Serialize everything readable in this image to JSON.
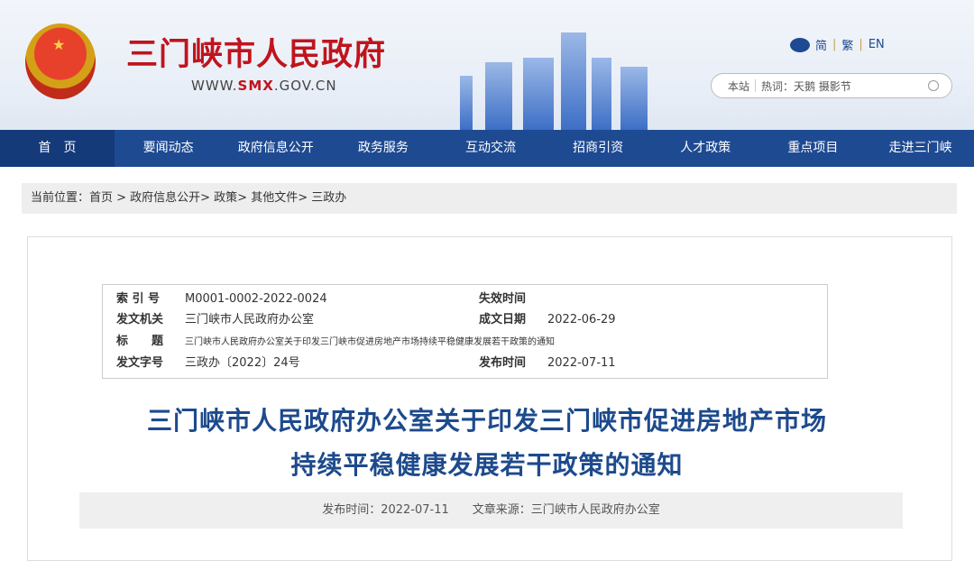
{
  "header": {
    "site_title": "三门峡市人民政府",
    "url_prefix": "WWW.",
    "url_brand": "SMX",
    "url_suffix": ".GOV.CN",
    "emblem_text": "★"
  },
  "lang": {
    "simplified": "简",
    "traditional": "繁",
    "english": "EN"
  },
  "search": {
    "scope": "本站",
    "hotwords": "热词：天鹅 摄影节"
  },
  "nav": [
    "首　页",
    "要闻动态",
    "政府信息公开",
    "政务服务",
    "互动交流",
    "招商引资",
    "人才政策",
    "重点项目",
    "走进三门峡"
  ],
  "breadcrumb": "当前位置：首页 > 政府信息公开> 政策> 其他文件> 三政办",
  "meta": {
    "index_label": "索 引 号",
    "index": "M0001-0002-2022-0024",
    "expire_label": "失效时间",
    "expire": "",
    "issuer_label": "发文机关",
    "issuer": "三门峡市人民政府办公室",
    "written_label": "成文日期",
    "written": "2022-06-29",
    "title_label": "标　　题",
    "title": "三门峡市人民政府办公室关于印发三门峡市促进房地产市场持续平稳健康发展若干政策的通知",
    "docno_label": "发文字号",
    "docno": "三政办〔2022〕24号",
    "publish_label": "发布时间",
    "publish": "2022-07-11"
  },
  "article": {
    "title_line1": "三门峡市人民政府办公室关于印发三门峡市促进房地产市场",
    "title_line2": "持续平稳健康发展若干政策的通知",
    "info": "发布时间：2022-07-11　　文章来源：三门峡市人民政府办公室"
  }
}
